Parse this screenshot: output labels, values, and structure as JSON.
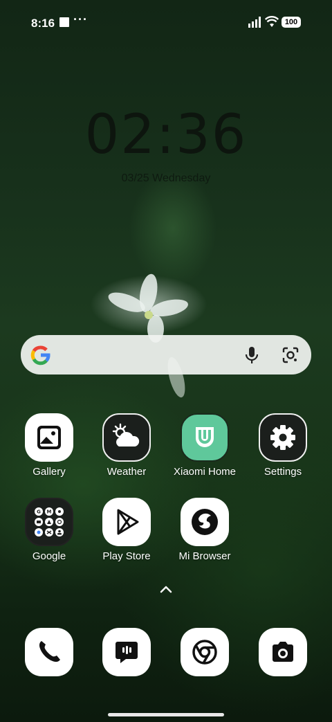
{
  "status_bar": {
    "time": "8:16",
    "more": "···",
    "battery": "100",
    "icons": [
      "square-notification-icon",
      "signal-icon",
      "wifi-icon",
      "battery-icon"
    ]
  },
  "clock": {
    "time": "02:36",
    "date": "03/25 Wednesday"
  },
  "search": {
    "icons": [
      "google-g-icon",
      "mic-icon",
      "lens-icon"
    ]
  },
  "apps": [
    {
      "label": "Gallery",
      "icon": "gallery-icon"
    },
    {
      "label": "Weather",
      "icon": "weather-icon"
    },
    {
      "label": "Xiaomi Home",
      "icon": "xiaomi-home-icon"
    },
    {
      "label": "Settings",
      "icon": "gear-icon"
    },
    {
      "label": "Google",
      "icon": "google-folder-icon"
    },
    {
      "label": "Play Store",
      "icon": "play-store-icon"
    },
    {
      "label": "Mi Browser",
      "icon": "mi-browser-icon"
    }
  ],
  "dock": [
    {
      "name": "phone",
      "icon": "phone-icon"
    },
    {
      "name": "messages",
      "icon": "message-icon"
    },
    {
      "name": "chrome",
      "icon": "chrome-icon"
    },
    {
      "name": "camera",
      "icon": "camera-icon"
    }
  ],
  "colors": {
    "accent_green": "#5fc89b",
    "search_bg": "#f0f3f0"
  }
}
